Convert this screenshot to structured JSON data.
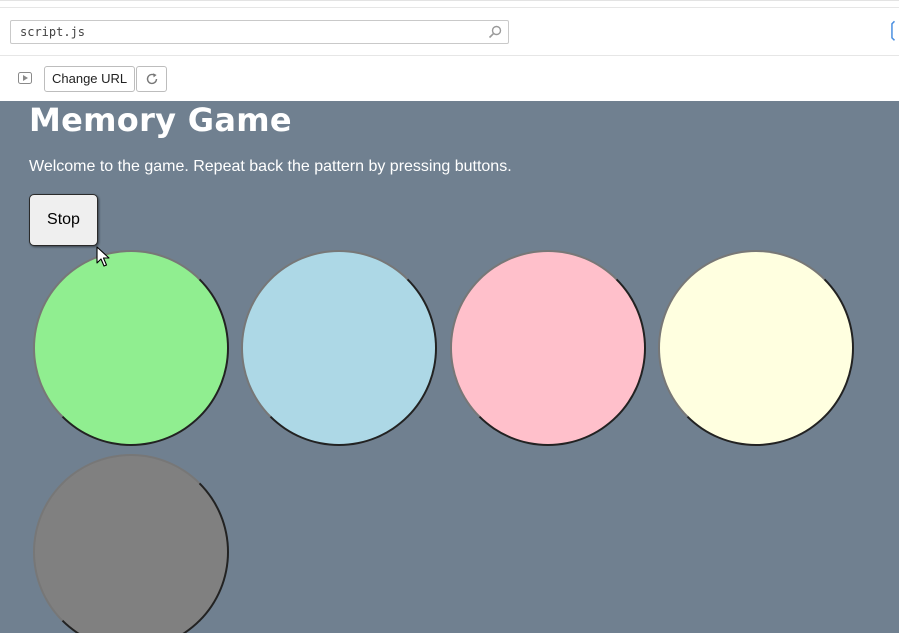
{
  "browser": {
    "address_value": "script.js",
    "change_url_label": "Change URL"
  },
  "game": {
    "title": "Memory Game",
    "intro": "Welcome to the game. Repeat back the pattern by pressing buttons.",
    "stop_label": "Stop",
    "pads": [
      {
        "name": "green",
        "color": "#90ee90"
      },
      {
        "name": "light-blue",
        "color": "#add8e6"
      },
      {
        "name": "pink",
        "color": "#ffc0cb"
      },
      {
        "name": "light-yellow",
        "color": "#ffffe0"
      },
      {
        "name": "gray",
        "color": "#808080"
      }
    ],
    "background_color": "#708090"
  },
  "icons": {
    "search": "search-icon",
    "play": "play-icon",
    "reload": "reload-icon",
    "cursor": "mouse-cursor-icon"
  }
}
